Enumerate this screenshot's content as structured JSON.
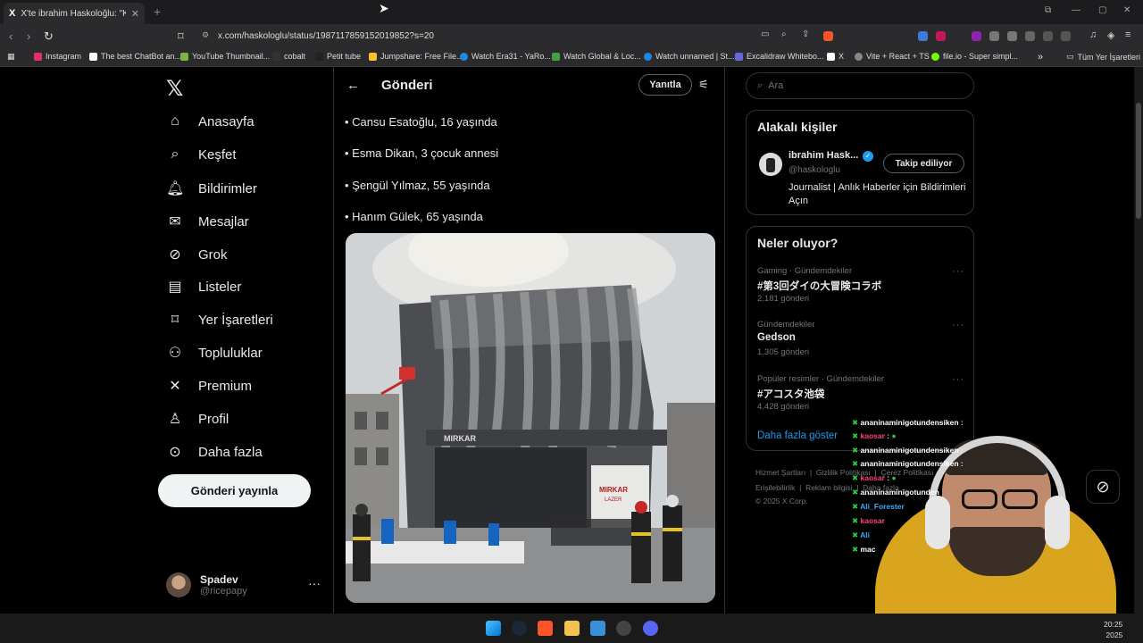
{
  "browser": {
    "tab_title": "X'te ibrahim Haskoloğlu: \"Kocae",
    "tab_favicon": "X",
    "url": "x.com/haskologlu/status/1987117859152019852?s=20",
    "bookmarks": [
      "Instagram",
      "The best ChatBot an...",
      "YouTube Thumbnail...",
      "cobalt",
      "Petit tube",
      "Jumpshare: Free File...",
      "Watch Era31 - YaRo...",
      "Watch Global & Loc...",
      "Watch unnamed | St...",
      "Excalidraw Whitebo...",
      "X",
      "Vite + React + TS",
      "file.io - Super simpl..."
    ],
    "bookmarks_folder": "Tüm Yer İşaretleri"
  },
  "nav": {
    "items": [
      {
        "label": "Anasayfa",
        "icon": "home-icon"
      },
      {
        "label": "Keşfet",
        "icon": "search-icon"
      },
      {
        "label": "Bildirimler",
        "icon": "bell-icon"
      },
      {
        "label": "Mesajlar",
        "icon": "mail-icon"
      },
      {
        "label": "Grok",
        "icon": "grok-icon"
      },
      {
        "label": "Listeler",
        "icon": "list-icon"
      },
      {
        "label": "Yer İşaretleri",
        "icon": "bookmark-icon"
      },
      {
        "label": "Topluluklar",
        "icon": "communities-icon"
      },
      {
        "label": "Premium",
        "icon": "x-icon"
      },
      {
        "label": "Profil",
        "icon": "profile-icon"
      },
      {
        "label": "Daha fazla",
        "icon": "more-icon"
      }
    ],
    "post_button": "Gönderi yayınla",
    "account": {
      "name": "Spadev",
      "handle": "@ricepapy"
    }
  },
  "main": {
    "title": "Gönderi",
    "reply_button": "Yanıtla",
    "lines": [
      "• Cansu Esatoğlu, 16 yaşında",
      "• Esma Dikan, 3 çocuk annesi",
      "• Şengül Yılmaz, 55 yaşında",
      "• Hanım Gülek, 65 yaşında"
    ],
    "photo_sign_1": "MIRKAR",
    "photo_sign_2": "LAZER"
  },
  "right": {
    "search_placeholder": "Ara",
    "related_title": "Alakalı kişiler",
    "related": {
      "name": "ibrahim Hask...",
      "handle": "@haskologlu",
      "follow_label": "Takip ediliyor",
      "bio": "Journalist | Anlık Haberler için Bildirimleri Açın"
    },
    "trends_title": "Neler oluyor?",
    "trends": [
      {
        "category": "Gaming · Gündemdekiler",
        "name": "#第3回ダイの大冒険コラボ",
        "count": "2.181 gönderi"
      },
      {
        "category": "Gündemdekiler",
        "name": "Gedson",
        "count": "1.305 gönderi"
      },
      {
        "category": "Popüler resimler · Gündemdekiler",
        "name": "#アコスタ池袋",
        "count": "4.428 gönderi"
      }
    ],
    "show_more": "Daha fazla göster",
    "footer_links_1": [
      "Hizmet Şartları",
      "Gizlilik Politikası",
      "Çerez Politikası"
    ],
    "footer_links_2": [
      "Erişilebilirlik",
      "Reklam bilgisi",
      "Daha fazla ..."
    ],
    "copyright": "© 2025 X Corp."
  },
  "chat": [
    {
      "user": "ananinaminigotundensiken",
      "msg": ":"
    },
    {
      "user": "kaosar",
      "msg": ":"
    },
    {
      "user": "ananinaminigotundensiken",
      "msg": ":"
    },
    {
      "user": "ananinaminigotundensiken",
      "msg": ":"
    },
    {
      "user": "kaosar",
      "msg": ":"
    },
    {
      "user": "ananinaminigotunden",
      "msg": ""
    },
    {
      "user": "Ali_Forester",
      "msg": ""
    },
    {
      "user": "kaosar",
      "msg": ""
    },
    {
      "user": "Ali",
      "msg": ""
    },
    {
      "user": "mac",
      "msg": ""
    }
  ],
  "clock": {
    "time": "20:25",
    "date": "2025"
  },
  "colors": {
    "accent": "#1d9bf0",
    "background": "#000000",
    "text": "#e7e9ea",
    "muted": "#71767b",
    "border": "#2f3336"
  }
}
